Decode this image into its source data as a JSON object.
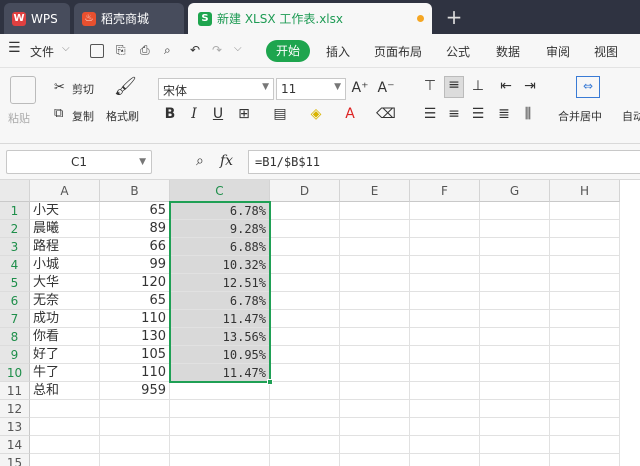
{
  "tabs": {
    "wps": "WPS",
    "store": "稻壳商城",
    "doc": "新建 XLSX 工作表.xlsx",
    "add": "+"
  },
  "menu": {
    "file": "文件",
    "start": "开始",
    "insert": "插入",
    "layout": "页面布局",
    "formula": "公式",
    "data": "数据",
    "review": "审阅",
    "view": "视图"
  },
  "ribbon": {
    "paste": "粘贴",
    "cut": "剪切",
    "copy": "复制",
    "format_painter": "格式刷",
    "font_name": "宋体",
    "font_size": "11",
    "merge": "合并居中",
    "auto": "自动"
  },
  "formula_bar": {
    "cell_ref": "C1",
    "fx": "fx",
    "formula": "=B1/$B$11"
  },
  "sheet": {
    "columns": [
      "A",
      "B",
      "C",
      "D",
      "E",
      "F",
      "G",
      "H"
    ],
    "rows": [
      "1",
      "2",
      "3",
      "4",
      "5",
      "6",
      "7",
      "8",
      "9",
      "10",
      "11",
      "12",
      "13",
      "14",
      "15"
    ],
    "col_a": [
      "小天",
      "晨曦",
      "路程",
      "小城",
      "大华",
      "无奈",
      "成功",
      "你看",
      "好了",
      "牛了",
      "总和"
    ],
    "col_b": [
      "65",
      "89",
      "66",
      "99",
      "120",
      "65",
      "110",
      "130",
      "105",
      "110",
      "959"
    ],
    "col_c": [
      "6.78%",
      "9.28%",
      "6.88%",
      "10.32%",
      "12.51%",
      "6.78%",
      "11.47%",
      "13.56%",
      "10.95%",
      "11.47%"
    ]
  },
  "colors": {
    "accent": "#1ea54e",
    "selection": "#1fa055"
  }
}
